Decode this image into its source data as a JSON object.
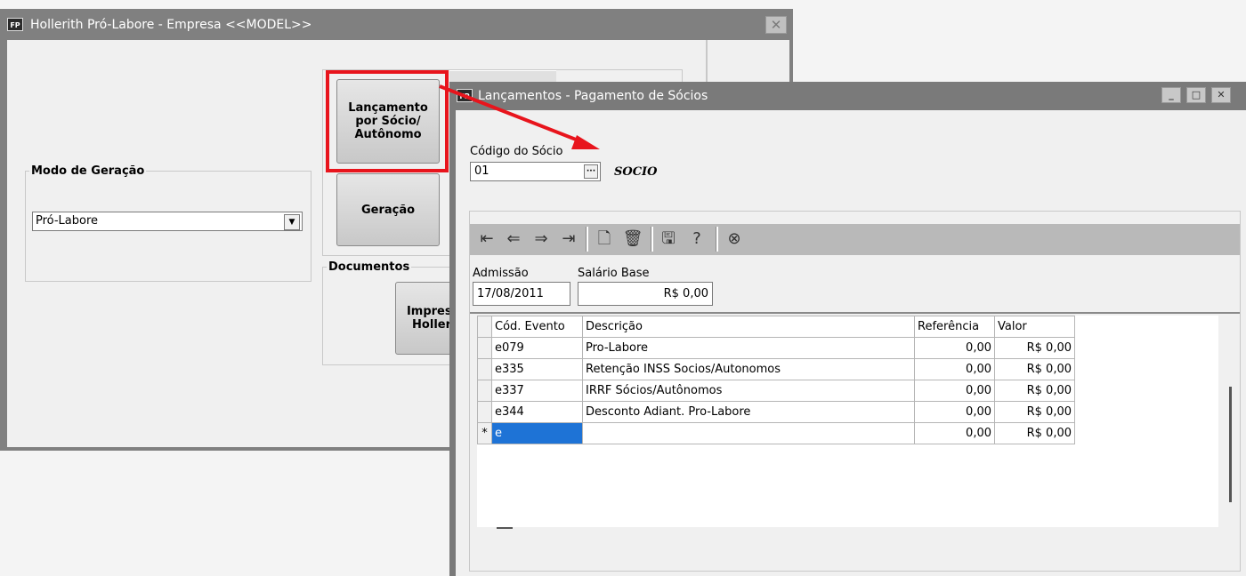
{
  "win1": {
    "app_icon": "FP",
    "title": "Hollerith Pró-Labore - Empresa <<MODEL>>",
    "close_label": "✕",
    "modo_group": {
      "legend": "Modo de Geração",
      "selected": "Pró-Labore"
    },
    "btn_lancamento": "Lançamento por Sócio/ Autônomo",
    "btn_geracao": "Geração",
    "documentos_group": {
      "legend": "Documentos",
      "btn_impressao": "Impressão Hollerith"
    }
  },
  "win2": {
    "app_icon": "FP",
    "title": "Lançamentos  - Pagamento de Sócios",
    "minimize": "_",
    "maximize": "□",
    "close": "✕",
    "codigo_label": "Código do Sócio",
    "codigo_value": "01",
    "lookup_btn": "···",
    "socio_name": "SOCIO",
    "toolbar_icons": [
      "first-icon",
      "prev-icon",
      "next-icon",
      "last-icon",
      "new-icon",
      "delete-icon",
      "save-icon",
      "help-icon",
      "cancel-icon"
    ],
    "admissao_label": "Admissão",
    "admissao_value": "17/08/2011",
    "salario_label": "Salário Base",
    "salario_value": "R$ 0,00",
    "grid": {
      "headers": [
        "Cód. Evento",
        "Descrição",
        "Referência",
        "Valor"
      ],
      "rows": [
        {
          "cod": "e079",
          "desc": "Pro-Labore",
          "ref": "0,00",
          "valor": "R$ 0,00"
        },
        {
          "cod": "e335",
          "desc": "Retenção INSS Socios/Autonomos",
          "ref": "0,00",
          "valor": "R$ 0,00"
        },
        {
          "cod": "e337",
          "desc": "IRRF Sócios/Autônomos",
          "ref": "0,00",
          "valor": "R$ 0,00"
        },
        {
          "cod": "e344",
          "desc": "Desconto Adiant. Pro-Labore",
          "ref": "0,00",
          "valor": "R$ 0,00"
        },
        {
          "marker": "*",
          "cod": "e",
          "desc": "",
          "ref": "0,00",
          "valor": "R$ 0,00"
        }
      ]
    }
  },
  "colors": {
    "highlight": "#e8141c",
    "selection": "#1e73d6",
    "title_bar": "#808080"
  }
}
